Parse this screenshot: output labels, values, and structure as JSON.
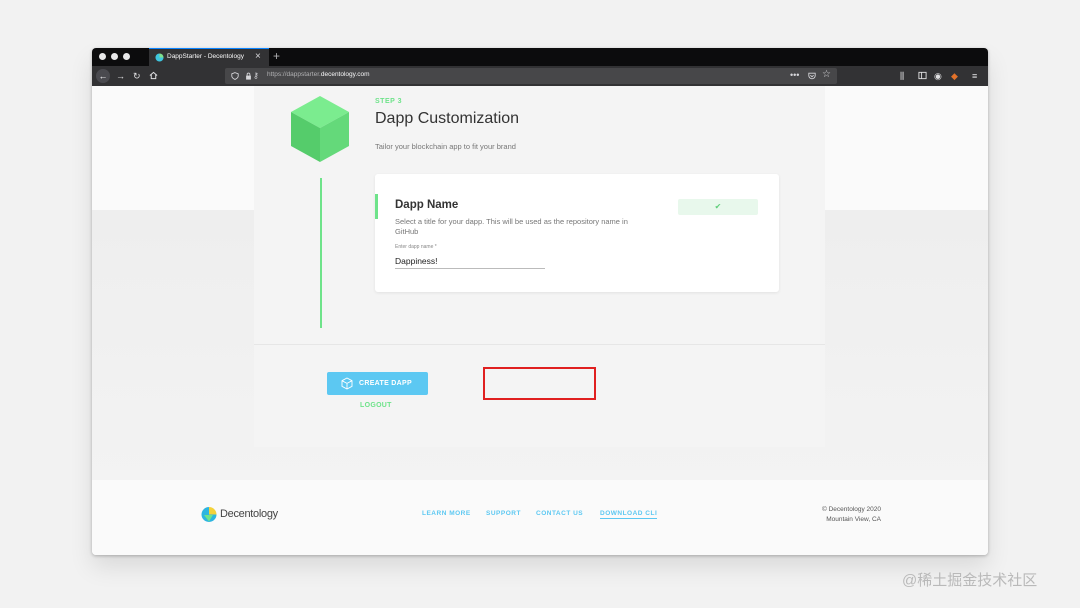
{
  "browser": {
    "tab_title": "DappStarter - Decentology",
    "tab_close": "×",
    "new_tab": "+",
    "url_prefix": "https://dappstarter.",
    "url_host": "decentology.com",
    "accent_color": "#0a84ff"
  },
  "step": {
    "label": "STEP 3",
    "title": "Dapp Customization",
    "subtitle": "Tailor your blockchain app to fit your brand"
  },
  "field": {
    "title": "Dapp Name",
    "description": "Select a title for your dapp. This will be used as the repository name in GitHub",
    "check": "✔",
    "input_label": "Enter dapp name *",
    "input_value": "Dappiness!"
  },
  "actions": {
    "create_label": "CREATE DAPP",
    "logout_label": "LOGOUT"
  },
  "footer": {
    "logo_text": "Decentology",
    "links": [
      "LEARN MORE",
      "SUPPORT",
      "CONTACT US",
      "DOWNLOAD CLI"
    ],
    "copyright_line1": "© Decentology 2020",
    "copyright_line2": "Mountain View, CA"
  },
  "watermark": "@稀土掘金技术社区",
  "colors": {
    "brand_green": "#6ee38a",
    "button_blue": "#5cc8f2",
    "highlight_red": "#e02020"
  }
}
